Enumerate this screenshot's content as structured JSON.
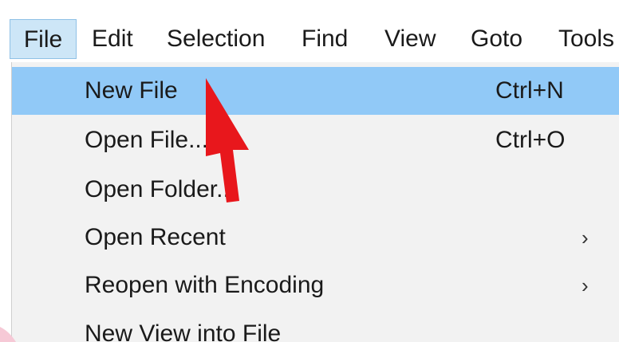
{
  "menubar": {
    "items": [
      {
        "label": "File",
        "active": true
      },
      {
        "label": "Edit"
      },
      {
        "label": "Selection"
      },
      {
        "label": "Find"
      },
      {
        "label": "View"
      },
      {
        "label": "Goto"
      },
      {
        "label": "Tools"
      }
    ]
  },
  "file_menu": {
    "items": [
      {
        "label": "New File",
        "shortcut": "Ctrl+N",
        "highlighted": true
      },
      {
        "label": "Open File...",
        "shortcut": "Ctrl+O"
      },
      {
        "label": "Open Folder..."
      },
      {
        "label": "Open Recent",
        "submenu": true
      },
      {
        "label": "Reopen with Encoding",
        "submenu": true
      },
      {
        "label": "New View into File"
      }
    ],
    "submenu_glyph": "›"
  },
  "colors": {
    "highlight": "#91c9f7",
    "menu_background": "#f2f2f2",
    "arrow": "#e8171c"
  },
  "icons": {
    "pointer_arrow": "red-arrow-icon"
  }
}
